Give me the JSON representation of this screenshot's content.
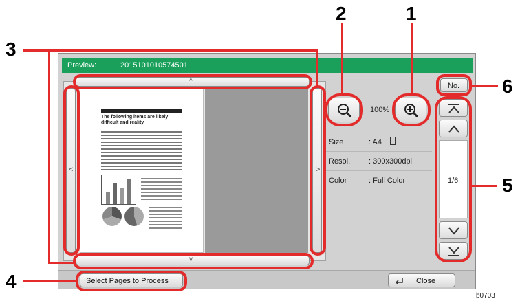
{
  "window": {
    "title_label": "Preview:",
    "title_value": "2015101010574501"
  },
  "zoom": {
    "level": "100%"
  },
  "info": [
    {
      "label": "Size",
      "value": ": A4"
    },
    {
      "label": "Resol.",
      "value": ": 300x300dpi"
    },
    {
      "label": "Color",
      "value": ": Full Color"
    }
  ],
  "pager": {
    "no_label": "No.",
    "page_indicator": "1/6"
  },
  "footer": {
    "select_pages_label": "Select Pages to Process",
    "close_label": "Close"
  },
  "document": {
    "heading": "The following items are likely difficult and reality"
  },
  "callouts": [
    "1",
    "2",
    "3",
    "4",
    "5",
    "6"
  ],
  "figure_code": "b0703",
  "colors": {
    "titlebar": "#1aa05a",
    "callout_outline": "#e32b2b"
  }
}
